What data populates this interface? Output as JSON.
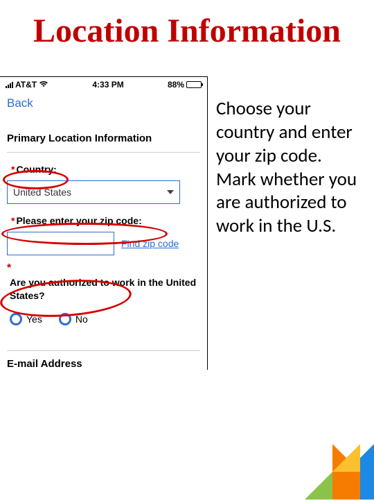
{
  "title": "Location Information",
  "instruction": "Choose your country and enter your zip code.  Mark whether you are authorized to work in the U.S.",
  "statusbar": {
    "carrier": "AT&T",
    "time": "4:33 PM",
    "battery": "88%"
  },
  "nav": {
    "back": "Back"
  },
  "section": {
    "heading": "Primary Location Information",
    "country_label": "Country:",
    "country_value": "United States",
    "zip_label": "Please enter your zip code:",
    "zip_value": "",
    "find_zip": "Find zip code",
    "auth_question": "Are you authorized to work in the United States?",
    "yes": "Yes",
    "no": "No",
    "email_heading": "E-mail Address"
  }
}
